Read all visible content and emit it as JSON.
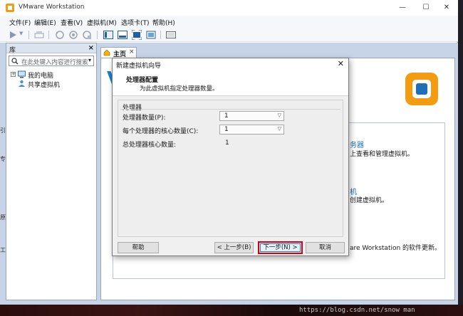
{
  "app": {
    "title": "VMware Workstation"
  },
  "menu": {
    "items": [
      "文件(F)",
      "编辑(E)",
      "查看(V)",
      "虚拟机(M)",
      "选项卡(T)",
      "帮助(H)"
    ]
  },
  "library": {
    "header": "库",
    "search_placeholder": "在此处键入内容进行搜索",
    "tree": [
      "我的电脑",
      "共享虚拟机"
    ]
  },
  "tab": {
    "label": "主页"
  },
  "home": {
    "link1": "务器",
    "desc1": "上查看和管理虚拟机。",
    "link2": "机",
    "desc2": "创建虚拟机。",
    "desc3": "are Workstation 的软件更新。"
  },
  "edge_fragments": [
    "引",
    "专",
    "原",
    "工"
  ],
  "dialog": {
    "title": "新建虚拟机向导",
    "heading": "处理器配置",
    "subheading": "为此虚拟机指定处理器数量。",
    "group_title": "处理器",
    "rows": [
      {
        "label": "处理器数量(P):",
        "value": "1"
      },
      {
        "label": "每个处理器的核心数量(C):",
        "value": "1"
      },
      {
        "label": "总处理器核心数量:",
        "value": "1"
      }
    ],
    "buttons": {
      "help": "帮助",
      "back": "< 上一步(B)",
      "next": "下一步(N) >",
      "cancel": "取消"
    }
  },
  "watermark": "https://blog.csdn.net/snow   man",
  "colors": {
    "accent": "#1b7fc4",
    "highlight": "#d0021b",
    "logo_orange": "#f39c12"
  }
}
